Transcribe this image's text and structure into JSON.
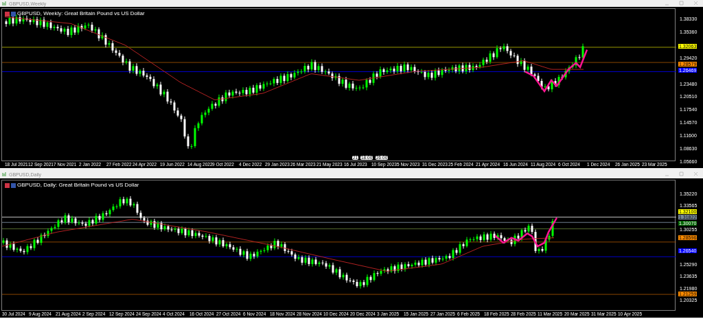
{
  "windows": [
    {
      "title": "GBPUSD,Weekly",
      "caption": "GBPUSD, Weekly:  Great Britain Pound vs US Dollar",
      "price_ticks": [
        "1.38330",
        "1.35360",
        "1.29420",
        "1.23480",
        "1.20510",
        "1.17540",
        "1.14570",
        "1.11600",
        "1.08630",
        "1.05660"
      ],
      "price_tags": [
        {
          "text": "1.32063",
          "color": "#ffff00"
        },
        {
          "text": "1.28579",
          "color": "#ff8c00"
        },
        {
          "text": "1.26469",
          "color": "#0000ff"
        }
      ],
      "time_markers": [
        "21",
        "18:00",
        "26:00"
      ],
      "date_ticks": [
        "18 Jul 2021",
        "12 Sep 2021",
        "7 Nov 2021",
        "2 Jan 2022",
        "27 Feb 2022",
        "24 Apr 2022",
        "19 Jun 2022",
        "14 Aug 2022",
        "9 Oct 2022",
        "4 Dec 2022",
        "29 Jan 2023",
        "26 Mar 2023",
        "21 May 2023",
        "16 Jul 2023",
        "10 Sep 2023",
        "5 Nov 2023",
        "31 Dec 2023",
        "25 Feb 2024",
        "21 Apr 2024",
        "16 Jun 2024",
        "11 Aug 2024",
        "6 Oct 2024",
        "1 Dec 2024",
        "26 Jan 2025",
        "23 Mar 2025"
      ]
    },
    {
      "title": "GBPUSD,Daily",
      "caption": "GBPUSD, Daily:  Great Britain Pound vs US Dollar",
      "price_ticks": [
        "1.35220",
        "1.33565",
        "1.30255",
        "1.25290",
        "1.23635",
        "1.21980",
        "1.20325"
      ],
      "price_tags": [
        {
          "text": "1.32100",
          "color": "#ffff00"
        },
        {
          "text": "1.31822",
          "color": "#778899"
        },
        {
          "text": "1.30070",
          "color": "#006400"
        },
        {
          "text": "1.28596",
          "color": "#ff8c00"
        },
        {
          "text": "1.26540",
          "color": "#0000ff"
        },
        {
          "text": "1.21259",
          "color": "#ff8c00"
        }
      ],
      "date_ticks": [
        "30 Jul 2024",
        "9 Aug 2024",
        "21 Aug 2024",
        "2 Sep 2024",
        "12 Sep 2024",
        "24 Sep 2024",
        "4 Oct 2024",
        "16 Oct 2024",
        "27 Oct 2024",
        "6 Nov 2024",
        "18 Nov 2024",
        "28 Nov 2024",
        "10 Dec 2024",
        "20 Dec 2024",
        "3 Jan 2025",
        "15 Jan 2025",
        "27 Jan 2025",
        "6 Feb 2025",
        "18 Feb 2025",
        "28 Feb 2025",
        "11 Mar 2025",
        "20 Mar 2025",
        "31 Mar 2025",
        "10 Apr 2025"
      ]
    }
  ]
}
